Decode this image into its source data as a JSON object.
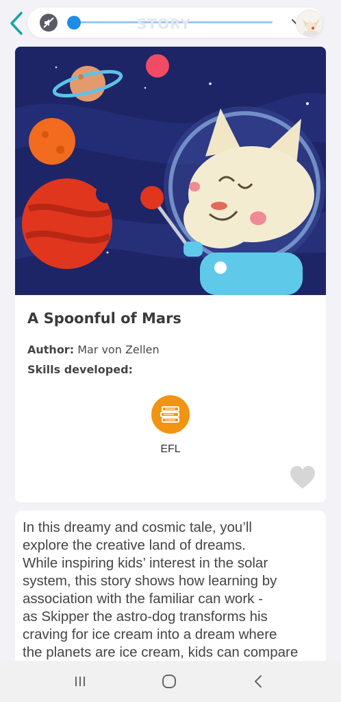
{
  "topbar": {
    "progress_label": "STORY",
    "progress_fraction": 0.0
  },
  "story": {
    "title": "A Spoonful of Mars",
    "author_label": "Author:",
    "author_name": "Mar von Zellen",
    "skills_label": "Skills developed:",
    "skills": [
      {
        "label": "EFL",
        "icon": "books-icon",
        "color": "#f39312"
      }
    ]
  },
  "description": {
    "text": "In this dreamy and cosmic tale, you’ll\nexplore the creative land of dreams.\nWhile inspiring kids’ interest in the solar\nsystem, this story shows how learning by\nassociation with the familiar can work -\nas Skipper the astro-dog transforms his\ncraving for ice cream into a dream where\nthe planets are ice cream, kids can compare"
  },
  "colors": {
    "accent_teal": "#1aa3a0",
    "progress_blue": "#1f8ce6",
    "skill_orange": "#f39312",
    "space_bg": "#1d2566"
  }
}
